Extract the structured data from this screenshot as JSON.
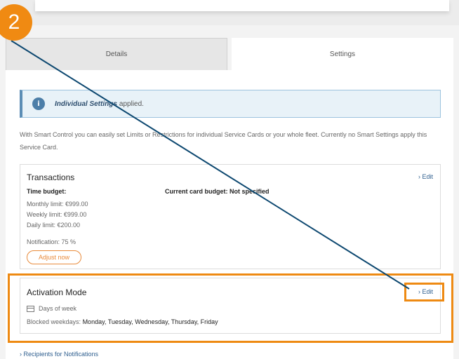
{
  "tabs": [
    {
      "label": "Details"
    },
    {
      "label": "Settings"
    }
  ],
  "info": {
    "icon": "i",
    "italic": "Individual Settings",
    "rest": "applied."
  },
  "description": "With Smart Control you can easily set Limits or Restrictions for individual Service Cards or your whole fleet. Currently no Smart Settings apply this Service Card.",
  "transactions": {
    "title": "Transactions",
    "edit": "› Edit",
    "time_budget_label": "Time budget:",
    "current_budget": "Current card budget: Not specified",
    "monthly": "Monthly limit: €999.00",
    "weekly": "Weekly limit: €999.00",
    "daily": "Daily limit: €200.00",
    "notification": "Notification: 75 %",
    "adjust": "Adjust now"
  },
  "activation": {
    "title": "Activation Mode",
    "edit": "› Edit",
    "days_label": "Days of week",
    "blocked_label": "Blocked weekdays:",
    "blocked_days": "Monday, Tuesday, Wednesday, Thursday, Friday"
  },
  "recipients": "› Recipients for Notifications",
  "step_badge": "2",
  "colors": {
    "accent": "#ee8a13",
    "link": "#2f5f8f",
    "pointer": "#0d4870"
  }
}
